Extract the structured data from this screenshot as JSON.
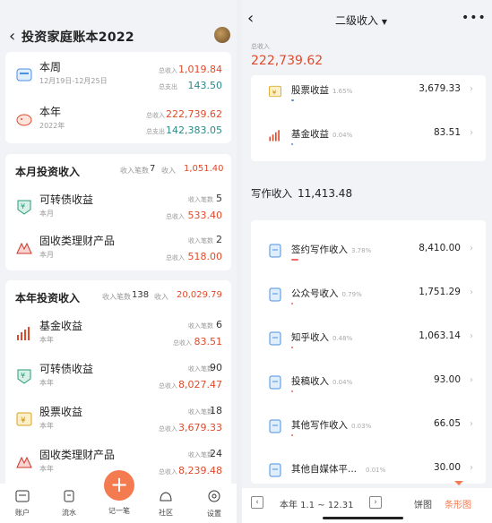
{
  "left": {
    "title": "投资家庭账本2022",
    "summary": [
      {
        "name": "本周",
        "sub": "12月19日-12月25日",
        "label1": "总收入",
        "value1": "1,019.84",
        "label2": "总支出",
        "value2": "143.50"
      },
      {
        "name": "本年",
        "sub": "2022年",
        "label1": "总收入",
        "value1": "222,739.62",
        "label2": "总支出",
        "value2": "142,383.05"
      }
    ],
    "month": {
      "title": "本月投资收入",
      "count_label": "收入笔数",
      "count": "7",
      "income_label": "收入",
      "income": "1,051.40",
      "items": [
        {
          "name": "可转债收益",
          "sub": "本月",
          "label1": "收入笔数",
          "value1": "5",
          "label2": "总收入",
          "value2": "533.40"
        },
        {
          "name": "固收类理财产品",
          "sub": "本月",
          "label1": "收入笔数",
          "value1": "2",
          "label2": "总收入",
          "value2": "518.00"
        }
      ]
    },
    "year": {
      "title": "本年投资收入",
      "count_label": "收入笔数",
      "count": "138",
      "income_label": "收入",
      "income": "20,029.79",
      "items": [
        {
          "name": "基金收益",
          "sub": "本年",
          "label1": "收入笔数",
          "value1": "6",
          "label2": "总收入",
          "value2": "83.51"
        },
        {
          "name": "可转债收益",
          "sub": "本年",
          "label1": "收入笔数",
          "value1": "90",
          "label2": "总收入",
          "value2": "8,027.47"
        },
        {
          "name": "股票收益",
          "sub": "本年",
          "label1": "收入笔数",
          "value1": "18",
          "label2": "总收入",
          "value2": "3,679.33"
        },
        {
          "name": "固收类理财产品",
          "sub": "本年",
          "label1": "收入笔数",
          "value1": "24",
          "label2": "总收入",
          "value2": "8,239.48"
        }
      ]
    },
    "nav": [
      "账户",
      "流水",
      "记一笔",
      "社区",
      "设置"
    ]
  },
  "right": {
    "title": "二级收入",
    "total_label": "总收入",
    "total": "222,739.62",
    "top_items": [
      {
        "name": "股票收益",
        "pct": "1.65%",
        "pct_value": 1.65,
        "value": "3,679.33"
      },
      {
        "name": "基金收益",
        "pct": "0.04%",
        "pct_value": 0.04,
        "value": "83.51"
      }
    ],
    "writing": {
      "title": "写作收入",
      "total": "11,413.48",
      "items": [
        {
          "name": "签约写作收入",
          "pct": "3.78%",
          "pct_value": 3.78,
          "value": "8,410.00"
        },
        {
          "name": "公众号收入",
          "pct": "0.79%",
          "pct_value": 0.79,
          "value": "1,751.29"
        },
        {
          "name": "知乎收入",
          "pct": "0.48%",
          "pct_value": 0.48,
          "value": "1,063.14"
        },
        {
          "name": "投稿收入",
          "pct": "0.04%",
          "pct_value": 0.04,
          "value": "93.00"
        },
        {
          "name": "其他写作收入",
          "pct": "0.03%",
          "pct_value": 0.03,
          "value": "66.05"
        },
        {
          "name": "其他自媒体平...",
          "pct": "0.01%",
          "pct_value": 0.01,
          "value": "30.00"
        }
      ]
    },
    "footer": {
      "range": "本年 1.1 ~ 12.31",
      "pie": "饼图",
      "bar": "条形图"
    }
  }
}
